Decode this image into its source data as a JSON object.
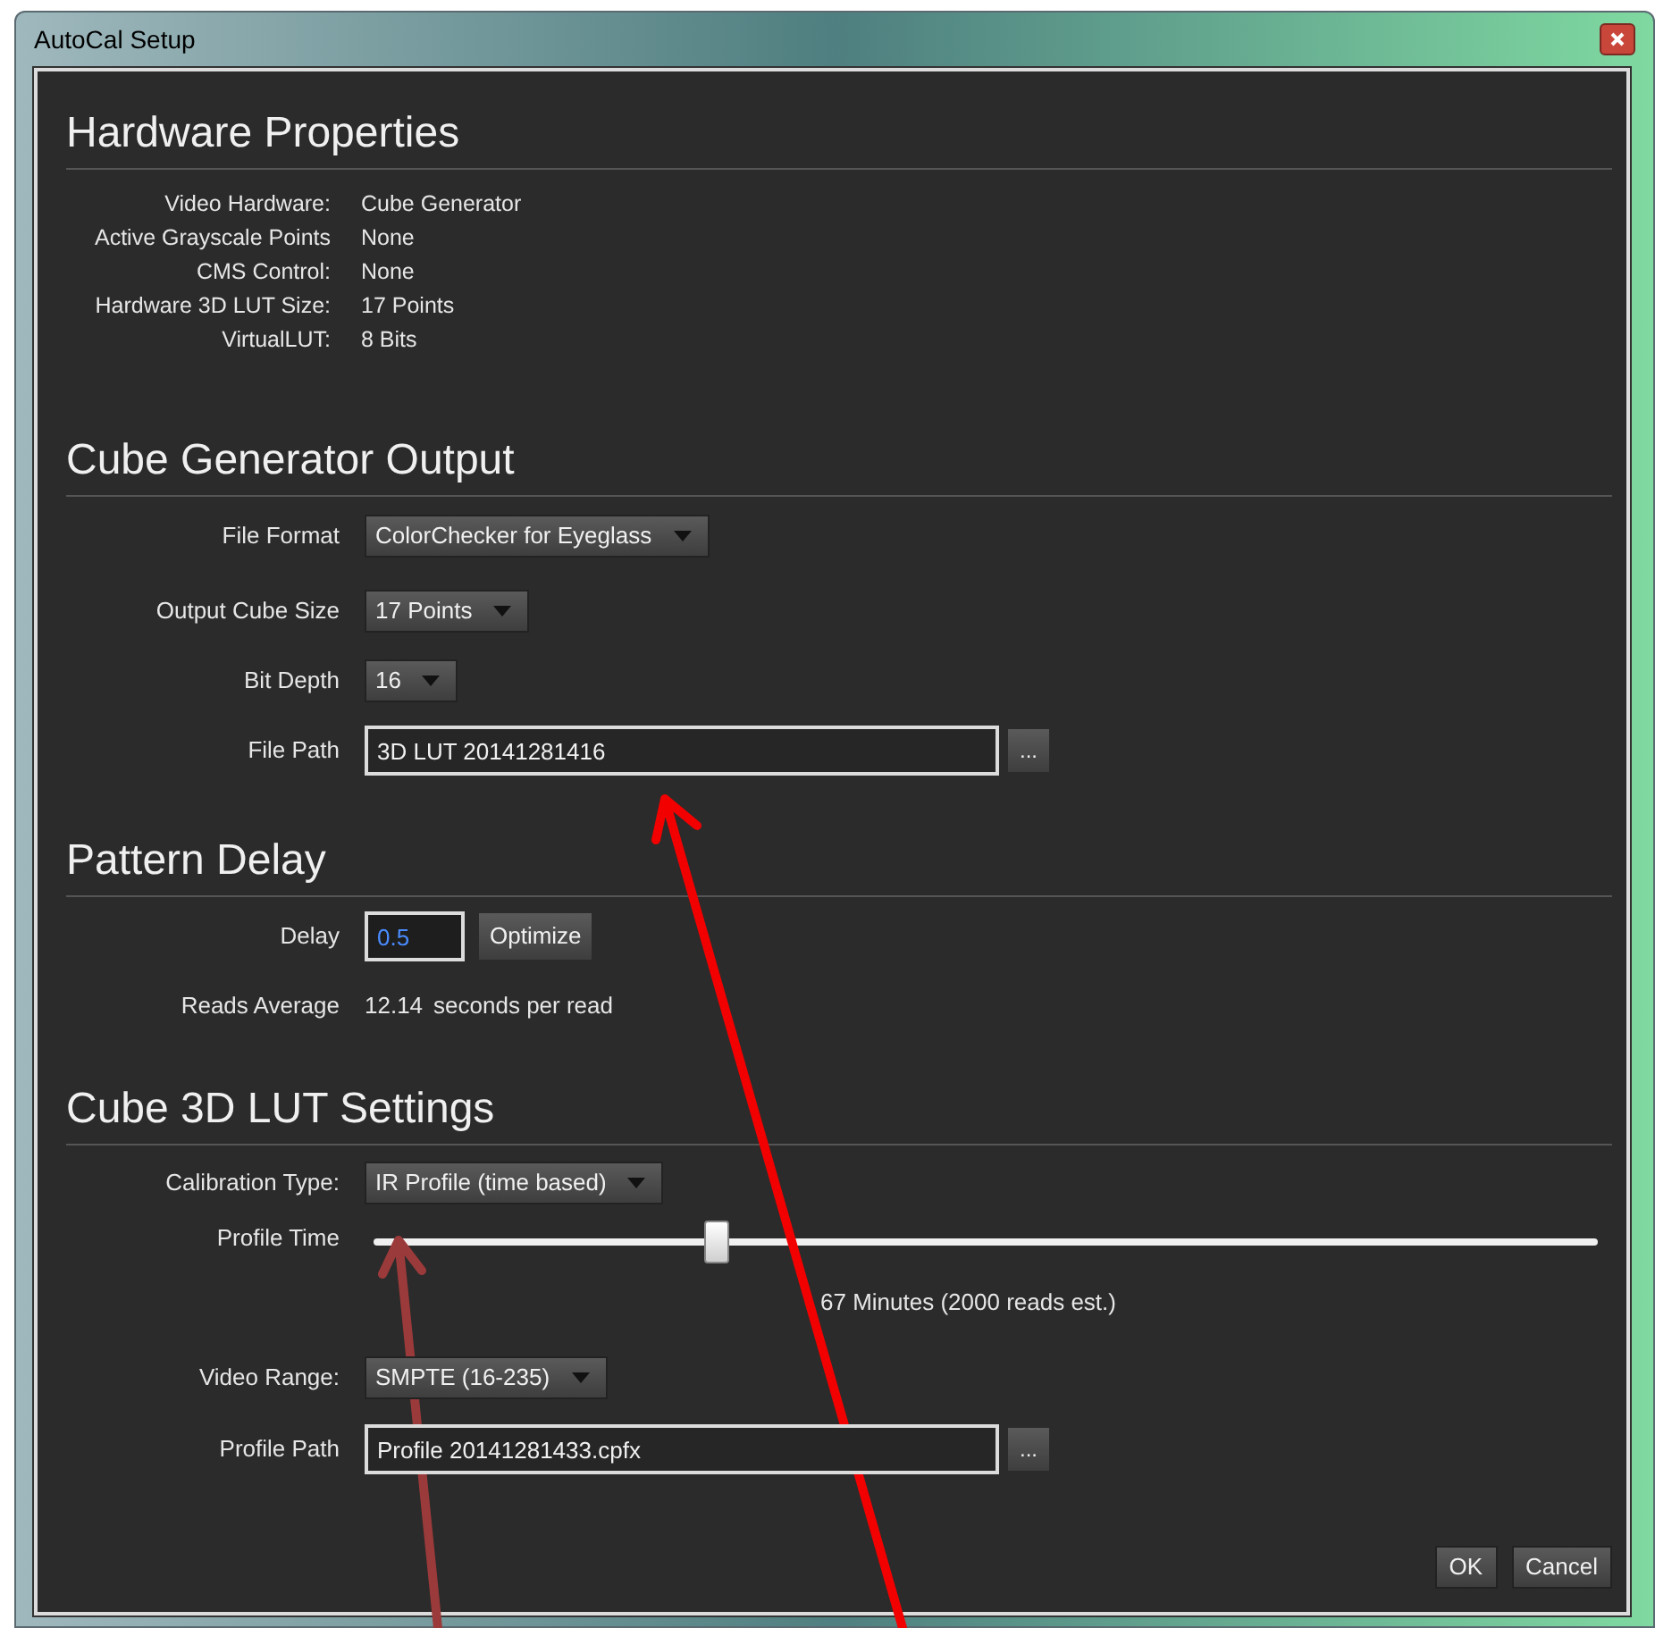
{
  "window": {
    "title": "AutoCal Setup"
  },
  "hardware_properties": {
    "title": "Hardware Properties",
    "rows": [
      {
        "label": "Video Hardware:",
        "value": "Cube Generator"
      },
      {
        "label": "Active Grayscale Points",
        "value": "None"
      },
      {
        "label": "CMS Control:",
        "value": "None"
      },
      {
        "label": "Hardware 3D LUT Size:",
        "value": "17 Points"
      },
      {
        "label": "VirtualLUT:",
        "value": "8 Bits"
      }
    ]
  },
  "cube_generator_output": {
    "title": "Cube Generator Output",
    "fields": [
      {
        "kind": "dropdown",
        "label": "File Format",
        "value": "ColorChecker for Eyeglass"
      },
      {
        "kind": "dropdown",
        "label": "Output Cube Size",
        "value": "17 Points"
      },
      {
        "kind": "dropdown",
        "label": "Bit Depth",
        "value": "16"
      },
      {
        "kind": "path",
        "label": "File Path",
        "value": "3D LUT 20141281416",
        "browse": "..."
      }
    ]
  },
  "pattern_delay": {
    "title": "Pattern Delay",
    "fields": [
      {
        "kind": "delay",
        "label": "Delay",
        "value": "0.5",
        "button": "Optimize"
      },
      {
        "kind": "reading",
        "label": "Reads Average",
        "value": "12.14",
        "unit": "seconds per read"
      }
    ]
  },
  "cube_3d_lut_settings": {
    "title": "Cube 3D LUT Settings",
    "fields": [
      {
        "kind": "dropdown",
        "label": "Calibration Type:",
        "value": "IR Profile (time based)"
      },
      {
        "kind": "slider",
        "label": "Profile Time",
        "level": 0.28,
        "reading": "67 Minutes (2000 reads est.)"
      },
      {
        "kind": "dropdown",
        "label": "Video Range:",
        "value": "SMPTE (16-235)"
      },
      {
        "kind": "path",
        "label": "Profile Path",
        "value": "Profile 20141281433.cpfx",
        "browse": "..."
      }
    ]
  },
  "buttons": [
    "OK",
    "Cancel"
  ]
}
